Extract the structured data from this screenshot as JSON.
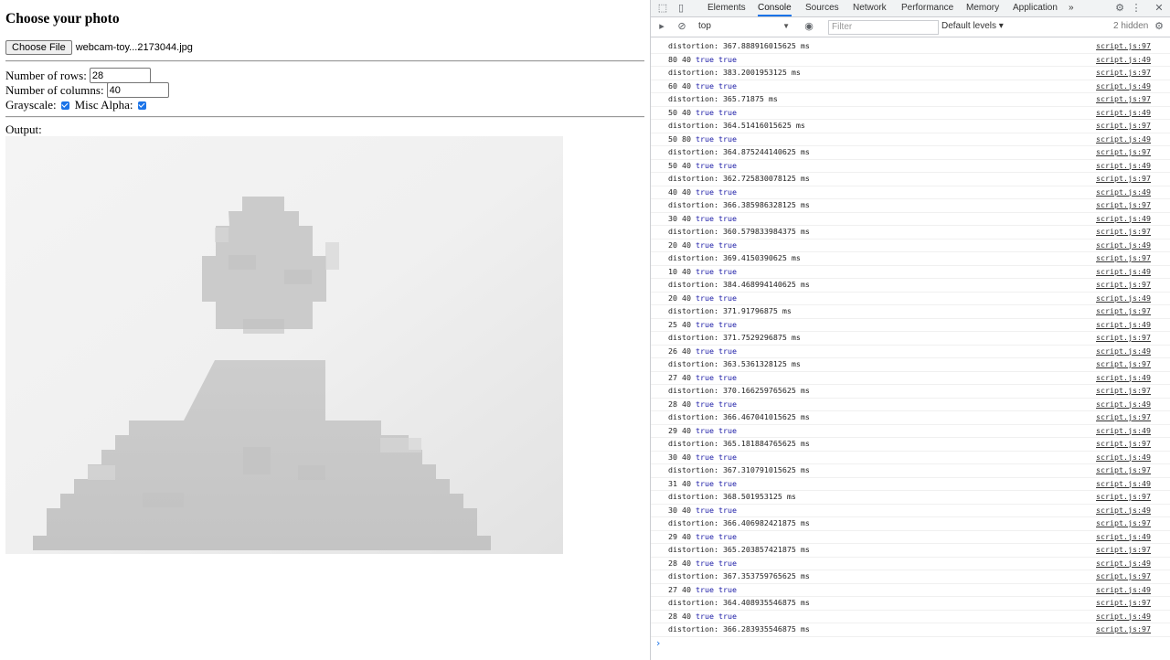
{
  "page": {
    "heading": "Choose your photo",
    "choose_file_label": "Choose File",
    "file_name": "webcam-toy...2173044.jpg",
    "rows_label": "Number of rows:",
    "rows_value": "28",
    "cols_label": "Number of columns:",
    "cols_value": "40",
    "grayscale_label": "Grayscale:",
    "misc_alpha_label": "Misc Alpha:",
    "output_label": "Output:"
  },
  "devtools": {
    "tabs": [
      "Elements",
      "Console",
      "Sources",
      "Network",
      "Performance",
      "Memory",
      "Application"
    ],
    "active_tab": "Console",
    "more_tabs": "»",
    "context": "top",
    "filter_placeholder": "Filter",
    "levels": "Default levels ▾",
    "hidden": "2 hidden",
    "accent_color": "#1a73e8"
  },
  "console": [
    {
      "msg": "distortion: 367.888916015625 ms",
      "src": "script.js:97"
    },
    {
      "msg": "80 40 true true",
      "src": "script.js:49"
    },
    {
      "msg": "distortion: 383.2001953125 ms",
      "src": "script.js:97"
    },
    {
      "msg": "60 40 true true",
      "src": "script.js:49"
    },
    {
      "msg": "distortion: 365.71875 ms",
      "src": "script.js:97"
    },
    {
      "msg": "50 40 true true",
      "src": "script.js:49"
    },
    {
      "msg": "distortion: 364.51416015625 ms",
      "src": "script.js:97"
    },
    {
      "msg": "50 80 true true",
      "src": "script.js:49"
    },
    {
      "msg": "distortion: 364.875244140625 ms",
      "src": "script.js:97"
    },
    {
      "msg": "50 40 true true",
      "src": "script.js:49"
    },
    {
      "msg": "distortion: 362.725830078125 ms",
      "src": "script.js:97"
    },
    {
      "msg": "40 40 true true",
      "src": "script.js:49"
    },
    {
      "msg": "distortion: 366.385986328125 ms",
      "src": "script.js:97"
    },
    {
      "msg": "30 40 true true",
      "src": "script.js:49"
    },
    {
      "msg": "distortion: 360.579833984375 ms",
      "src": "script.js:97"
    },
    {
      "msg": "20 40 true true",
      "src": "script.js:49"
    },
    {
      "msg": "distortion: 369.4150390625 ms",
      "src": "script.js:97"
    },
    {
      "msg": "10 40 true true",
      "src": "script.js:49"
    },
    {
      "msg": "distortion: 384.468994140625 ms",
      "src": "script.js:97"
    },
    {
      "msg": "20 40 true true",
      "src": "script.js:49"
    },
    {
      "msg": "distortion: 371.91796875 ms",
      "src": "script.js:97"
    },
    {
      "msg": "25 40 true true",
      "src": "script.js:49"
    },
    {
      "msg": "distortion: 371.7529296875 ms",
      "src": "script.js:97"
    },
    {
      "msg": "26 40 true true",
      "src": "script.js:49"
    },
    {
      "msg": "distortion: 363.5361328125 ms",
      "src": "script.js:97"
    },
    {
      "msg": "27 40 true true",
      "src": "script.js:49"
    },
    {
      "msg": "distortion: 370.166259765625 ms",
      "src": "script.js:97"
    },
    {
      "msg": "28 40 true true",
      "src": "script.js:49"
    },
    {
      "msg": "distortion: 366.467041015625 ms",
      "src": "script.js:97"
    },
    {
      "msg": "29 40 true true",
      "src": "script.js:49"
    },
    {
      "msg": "distortion: 365.181884765625 ms",
      "src": "script.js:97"
    },
    {
      "msg": "30 40 true true",
      "src": "script.js:49"
    },
    {
      "msg": "distortion: 367.310791015625 ms",
      "src": "script.js:97"
    },
    {
      "msg": "31 40 true true",
      "src": "script.js:49"
    },
    {
      "msg": "distortion: 368.501953125 ms",
      "src": "script.js:97"
    },
    {
      "msg": "30 40 true true",
      "src": "script.js:49"
    },
    {
      "msg": "distortion: 366.406982421875 ms",
      "src": "script.js:97"
    },
    {
      "msg": "29 40 true true",
      "src": "script.js:49"
    },
    {
      "msg": "distortion: 365.203857421875 ms",
      "src": "script.js:97"
    },
    {
      "msg": "28 40 true true",
      "src": "script.js:49"
    },
    {
      "msg": "distortion: 367.353759765625 ms",
      "src": "script.js:97"
    },
    {
      "msg": "27 40 true true",
      "src": "script.js:49"
    },
    {
      "msg": "distortion: 364.408935546875 ms",
      "src": "script.js:97"
    },
    {
      "msg": "28 40 true true",
      "src": "script.js:49"
    },
    {
      "msg": "distortion: 366.283935546875 ms",
      "src": "script.js:97"
    }
  ]
}
